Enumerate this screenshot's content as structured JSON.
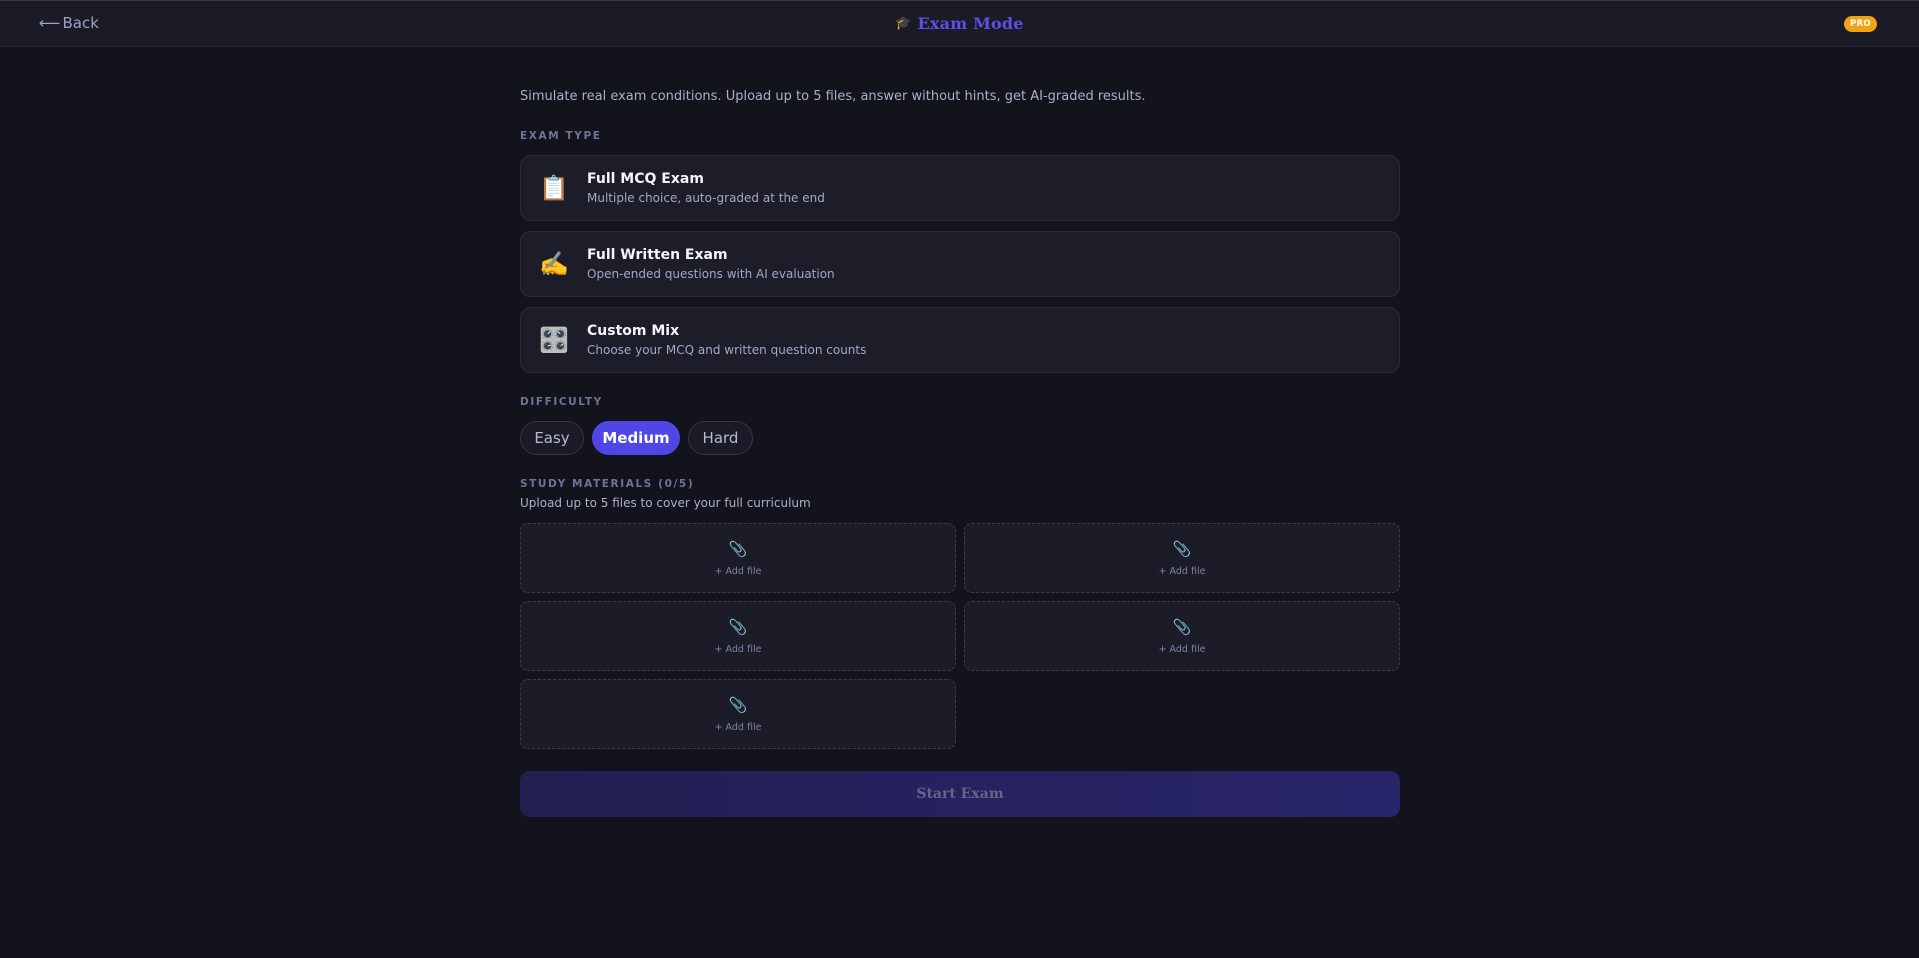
{
  "header": {
    "back_label": "Back",
    "back_arrow": "⟵",
    "title_icon": "🎓",
    "title": "Exam Mode",
    "badge": "PRO"
  },
  "intro": "Simulate real exam conditions. Upload up to 5 files, answer without hints, get AI-graded results.",
  "exam_type": {
    "label": "EXAM TYPE",
    "options": [
      {
        "icon": "📋",
        "icon_name": "clipboard-icon",
        "title": "Full MCQ Exam",
        "desc": "Multiple choice, auto-graded at the end"
      },
      {
        "icon": "✍️",
        "icon_name": "writing-hand-icon",
        "title": "Full Written Exam",
        "desc": "Open-ended questions with AI evaluation"
      },
      {
        "icon": "🎛️",
        "icon_name": "control-knobs-icon",
        "title": "Custom Mix",
        "desc": "Choose your MCQ and written question counts"
      }
    ]
  },
  "difficulty": {
    "label": "DIFFICULTY",
    "options": [
      "Easy",
      "Medium",
      "Hard"
    ],
    "selected": "Medium"
  },
  "materials": {
    "label": "STUDY MATERIALS (0/5)",
    "subtitle": "Upload up to 5 files to cover your full curriculum",
    "slot_icon": "📎",
    "slot_label": "+ Add file",
    "slot_count": 5
  },
  "start_button": "Start Exam",
  "colors": {
    "background": "#13131d",
    "accent": "#4f46e5",
    "title": "#5a50e8",
    "badge": "#f0a414"
  }
}
